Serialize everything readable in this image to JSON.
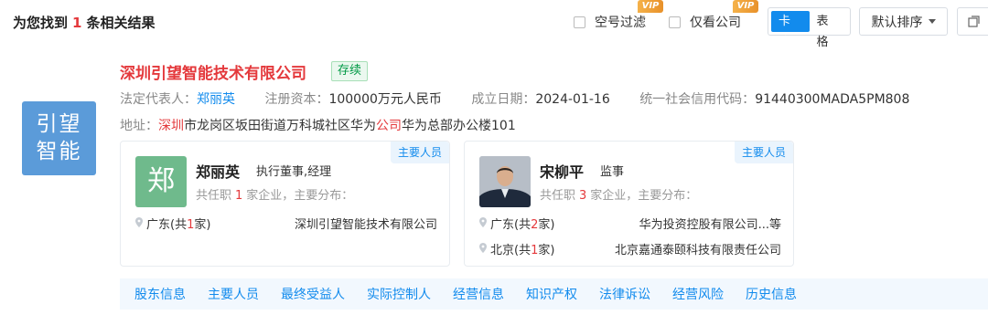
{
  "header": {
    "result_prefix": "为您找到",
    "result_count": "1",
    "result_suffix": "条相关结果",
    "filters": [
      {
        "label": "空号过滤",
        "badge": "VIP"
      },
      {
        "label": "仅看公司",
        "badge": "VIP"
      }
    ],
    "view_toggle": {
      "card": "卡片",
      "table": "表格"
    },
    "sort_label": "默认排序"
  },
  "company": {
    "logo_line1": "引望",
    "logo_line2": "智能",
    "name": "深圳引望智能技术有限公司",
    "status": "存续",
    "legal_rep_label": "法定代表人：",
    "legal_rep": "郑丽英",
    "capital_label": "注册资本：",
    "capital": "100000万元人民币",
    "founded_label": "成立日期：",
    "founded": "2024-01-16",
    "credit_code_label": "统一社会信用代码：",
    "credit_code": "91440300MADA5PM808",
    "address_label": "地址：",
    "address_hl1": "深圳",
    "address_part1": "市龙岗区坂田街道万科城社区华为",
    "address_hl2": "公司",
    "address_part2": "华为总部办公楼101"
  },
  "persons": [
    {
      "tag": "主要人员",
      "avatar_char": "郑",
      "name": "郑丽英",
      "role": "执行董事,经理",
      "stat_prefix": "共任职",
      "stat_count": "1",
      "stat_suffix": "家企业，主要分布：",
      "locations": [
        {
          "prefix": "广东(共",
          "count": "1",
          "suffix": "家)",
          "company": "深圳引望智能技术有限公司"
        }
      ]
    },
    {
      "tag": "主要人员",
      "avatar_char": "",
      "name": "宋柳平",
      "role": "监事",
      "stat_prefix": "共任职",
      "stat_count": "3",
      "stat_suffix": "家企业，主要分布：",
      "locations": [
        {
          "prefix": "广东(共",
          "count": "2",
          "suffix": "家)",
          "company": "华为投资控股有限公司...等"
        },
        {
          "prefix": "北京(共",
          "count": "1",
          "suffix": "家)",
          "company": "北京嘉通泰颐科技有限责任公司"
        }
      ]
    }
  ],
  "tabs": [
    "股东信息",
    "主要人员",
    "最终受益人",
    "实际控制人",
    "经营信息",
    "知识产权",
    "法律诉讼",
    "经营风险",
    "历史信息"
  ],
  "colors": {
    "accent": "#128bed",
    "highlight": "#e4393c",
    "logo_bg": "#5b9bd9",
    "status_green": "#009944"
  }
}
